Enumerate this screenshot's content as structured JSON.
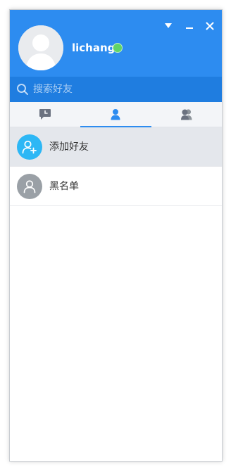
{
  "header": {
    "username": "lichang",
    "status": "online",
    "status_color": "#5fd466",
    "background_color": "#2d8cf0",
    "window_controls": [
      "menu-down-icon",
      "minimize-icon",
      "close-icon"
    ]
  },
  "search": {
    "placeholder": "搜索好友",
    "value": "",
    "icon": "search-icon"
  },
  "tabs": [
    {
      "icon": "message-clock-icon",
      "active": false
    },
    {
      "icon": "person-icon",
      "active": true
    },
    {
      "icon": "group-icon",
      "active": false
    }
  ],
  "list": {
    "items": [
      {
        "label": "添加好友",
        "icon": "add-user-icon",
        "icon_color": "#2db7f5",
        "selected": true
      },
      {
        "label": "黑名单",
        "icon": "user-icon",
        "icon_color": "#9aa0a6",
        "selected": false
      }
    ]
  },
  "colors": {
    "accent": "#2d8cf0",
    "search_background": "#1f7de0",
    "selected_row": "#e4e7ec"
  }
}
